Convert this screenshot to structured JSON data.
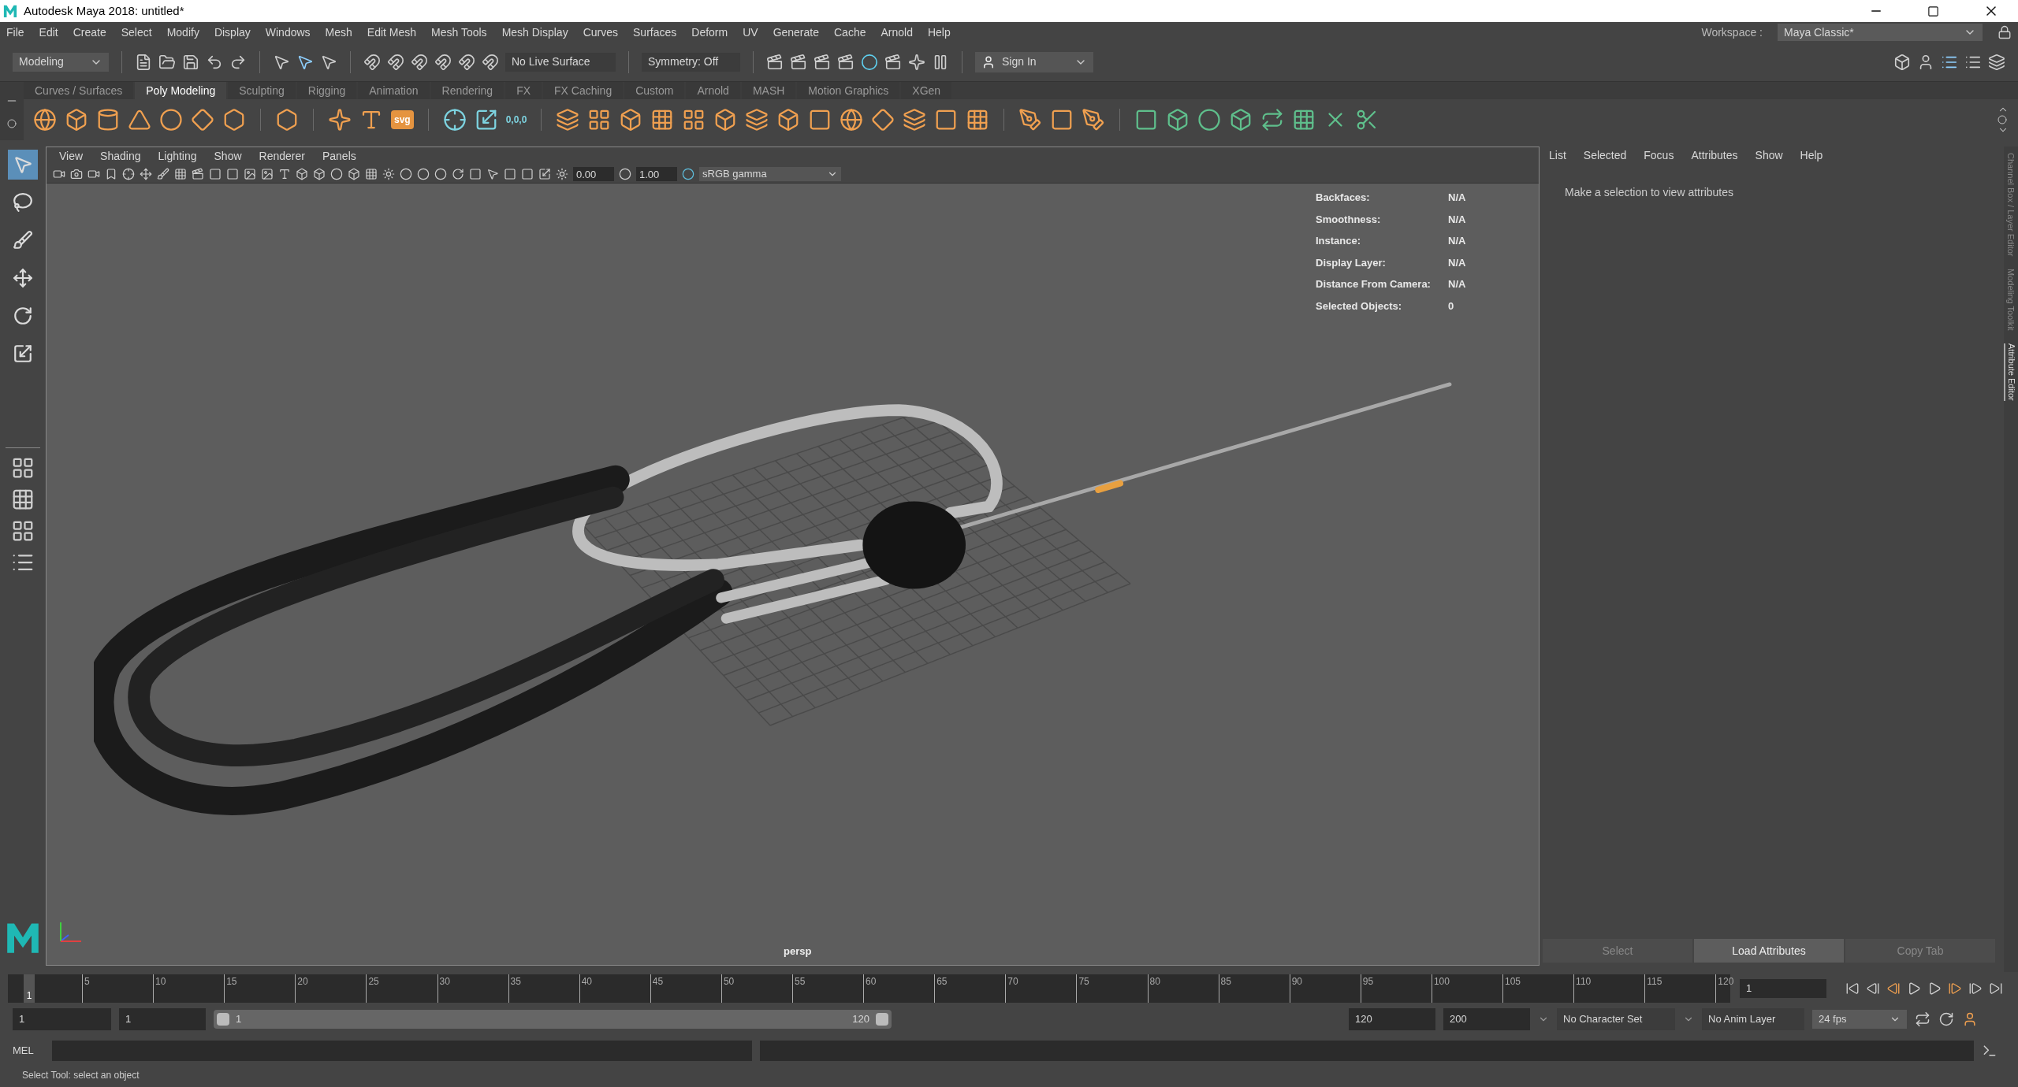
{
  "window": {
    "title": "Autodesk Maya 2018: untitled*"
  },
  "menu_bar": [
    "File",
    "Edit",
    "Create",
    "Select",
    "Modify",
    "Display",
    "Windows",
    "Mesh",
    "Edit Mesh",
    "Mesh Tools",
    "Mesh Display",
    "Curves",
    "Surfaces",
    "Deform",
    "UV",
    "Generate",
    "Cache",
    "Arnold",
    "Help"
  ],
  "status_line": {
    "mode": "Modeling",
    "live_surface": "No Live Surface",
    "symmetry": "Symmetry: Off",
    "sign_in": "Sign In",
    "workspace_label": "Workspace :",
    "workspace": "Maya Classic*"
  },
  "shelf": {
    "tabs": [
      {
        "label": "Curves / Surfaces",
        "selected": false
      },
      {
        "label": "Poly Modeling",
        "selected": true
      },
      {
        "label": "Sculpting",
        "selected": false
      },
      {
        "label": "Rigging",
        "selected": false
      },
      {
        "label": "Animation",
        "selected": false
      },
      {
        "label": "Rendering",
        "selected": false
      },
      {
        "label": "FX",
        "selected": false
      },
      {
        "label": "FX Caching",
        "selected": false
      },
      {
        "label": "Custom",
        "selected": false
      },
      {
        "label": "Arnold",
        "selected": false
      },
      {
        "label": "MASH",
        "selected": false
      },
      {
        "label": "Motion Graphics",
        "selected": false
      },
      {
        "label": "XGen",
        "selected": false
      }
    ],
    "svg_label": "svg",
    "origin_label": "0,0,0"
  },
  "toolbox": [
    {
      "selected": true
    },
    {
      "selected": false
    },
    {
      "selected": false
    },
    {
      "selected": false
    },
    {
      "selected": false
    },
    {
      "selected": false
    }
  ],
  "viewport": {
    "menu": [
      "View",
      "Shading",
      "Lighting",
      "Show",
      "Renderer",
      "Panels"
    ],
    "exposure": "0.00",
    "gamma": "1.00",
    "color_space": "sRGB gamma",
    "hud": [
      {
        "label": "Backfaces:",
        "value": "N/A"
      },
      {
        "label": "Smoothness:",
        "value": "N/A"
      },
      {
        "label": "Instance:",
        "value": "N/A"
      },
      {
        "label": "Display Layer:",
        "value": "N/A"
      },
      {
        "label": "Distance From Camera:",
        "value": "N/A"
      },
      {
        "label": "Selected Objects:",
        "value": "0"
      }
    ],
    "camera": "persp"
  },
  "attribute_editor": {
    "menu": [
      "List",
      "Selected",
      "Focus",
      "Attributes",
      "Show",
      "Help"
    ],
    "message": "Make a selection to view attributes",
    "buttons": [
      {
        "label": "Select",
        "disabled": true
      },
      {
        "label": "Load Attributes",
        "disabled": false
      },
      {
        "label": "Copy Tab",
        "disabled": true
      }
    ]
  },
  "side_tabs": [
    {
      "label": "Channel Box / Layer Editor",
      "selected": false
    },
    {
      "label": "Modeling Toolkit",
      "selected": false
    },
    {
      "label": "Attribute Editor",
      "selected": true
    }
  ],
  "timeline": {
    "ticks": [
      "5",
      "10",
      "15",
      "20",
      "25",
      "30",
      "35",
      "40",
      "45",
      "50",
      "55",
      "60",
      "65",
      "70",
      "75",
      "80",
      "85",
      "90",
      "95",
      "100",
      "105",
      "110",
      "115",
      "120"
    ],
    "playhead": "1",
    "level": 0,
    "current_frame": "1"
  },
  "range": {
    "start": "1",
    "playback_start": "1",
    "slider_start": "1",
    "slider_end": "120",
    "level": 1,
    "playback_end": "120",
    "end": "200",
    "character_set": "No Character Set",
    "anim_layer": "No Anim Layer",
    "fps": "24 fps"
  },
  "command_line": {
    "language": "MEL"
  },
  "help_line": "Select Tool: select an object"
}
